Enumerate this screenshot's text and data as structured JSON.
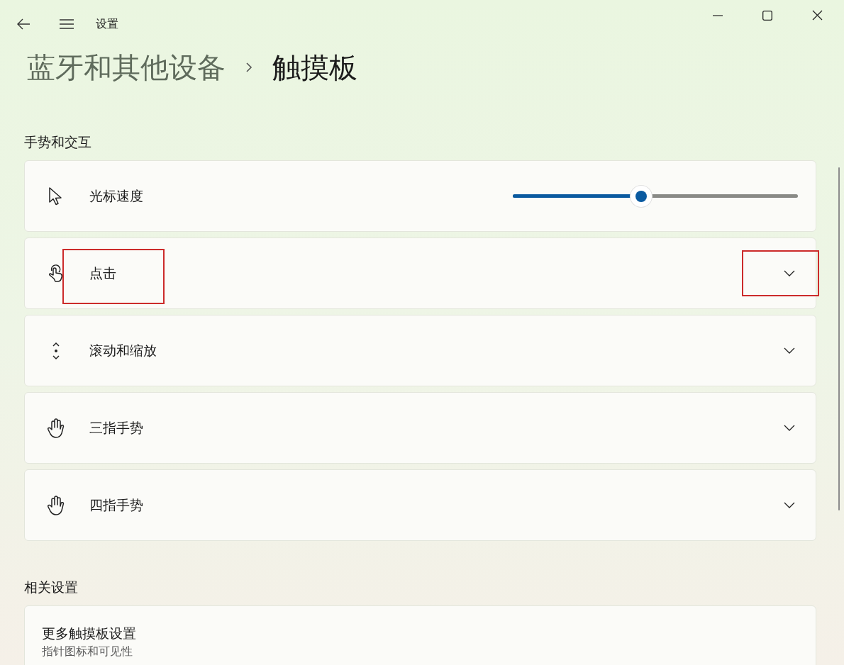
{
  "window": {
    "title": "设置"
  },
  "breadcrumb": [
    {
      "label": "蓝牙和其他设备",
      "current": false
    },
    {
      "label": "触摸板",
      "current": true
    }
  ],
  "sections": [
    {
      "title": "手势和交互",
      "items": [
        {
          "kind": "slider",
          "label": "光标速度",
          "level": 0.45,
          "annotated": false
        },
        {
          "kind": "expander",
          "label": "点击",
          "annotated": true
        },
        {
          "kind": "expander",
          "label": "滚动和缩放",
          "annotated": false
        },
        {
          "kind": "expander",
          "label": "三指手势",
          "annotated": false
        },
        {
          "kind": "expander",
          "label": "四指手势",
          "annotated": false
        }
      ]
    },
    {
      "title": "相关设置",
      "items": [
        {
          "kind": "link",
          "label": "更多触摸板设置",
          "description": "指针图标和可见性",
          "annotated": false
        }
      ]
    }
  ]
}
